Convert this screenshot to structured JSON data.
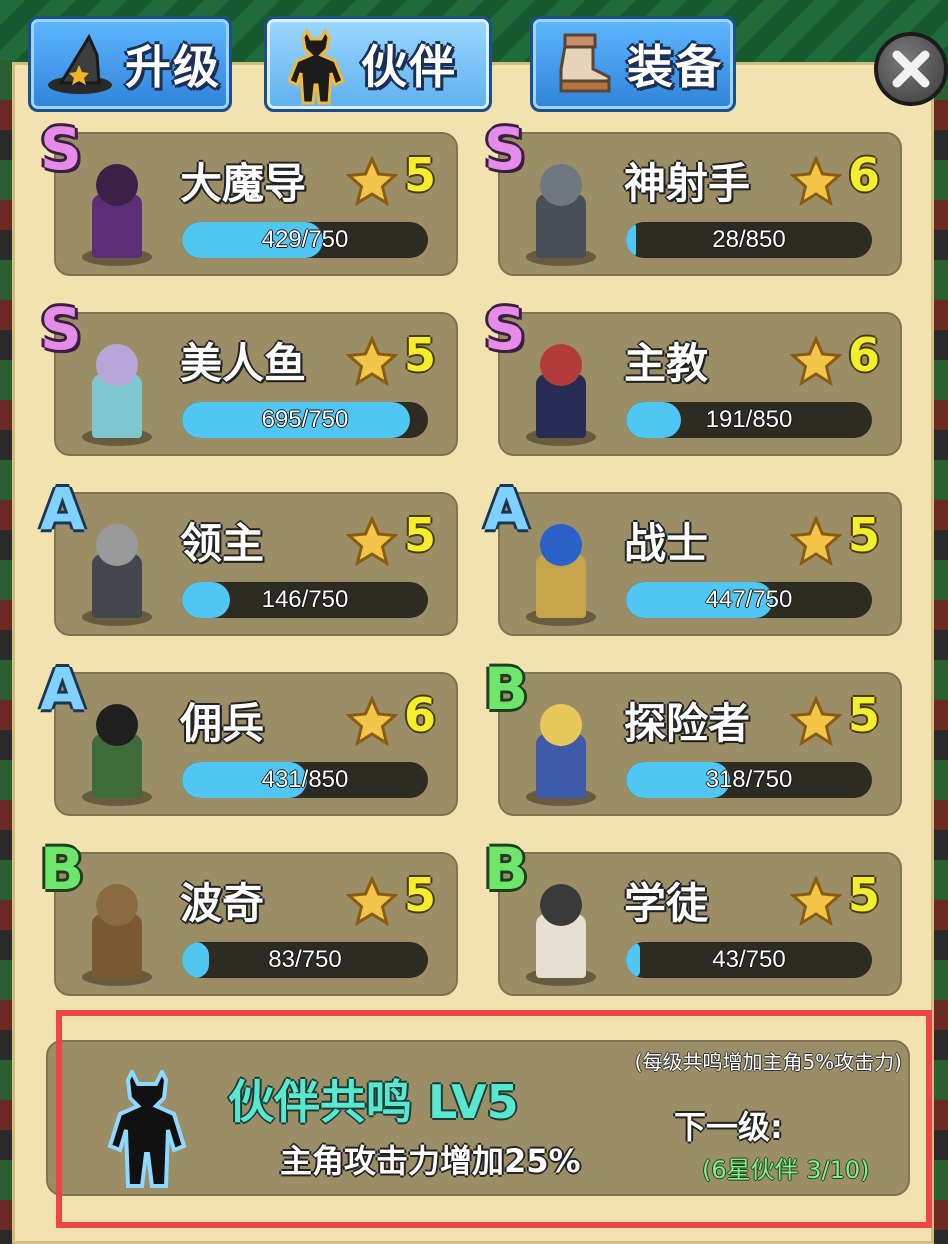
{
  "tabs": [
    {
      "label": "升级",
      "icon": "wizard-hat-icon",
      "active": false
    },
    {
      "label": "伙伴",
      "icon": "partner-silhouette-icon",
      "active": true
    },
    {
      "label": "装备",
      "icon": "boot-icon",
      "active": false
    }
  ],
  "close": {
    "icon": "close-icon"
  },
  "partners": [
    {
      "grade": "S",
      "name": "大魔导",
      "stars": "5",
      "progress_text": "429/750",
      "progress": 0.572,
      "colors": {
        "head": "#3b2148",
        "body": "#5a2f78"
      }
    },
    {
      "grade": "S",
      "name": "神射手",
      "stars": "6",
      "progress_text": "28/850",
      "progress": 0.033,
      "colors": {
        "head": "#6f7780",
        "body": "#4a4f57"
      }
    },
    {
      "grade": "S",
      "name": "美人鱼",
      "stars": "5",
      "progress_text": "695/750",
      "progress": 0.927,
      "colors": {
        "head": "#b9a6d9",
        "body": "#7fc7cf"
      }
    },
    {
      "grade": "S",
      "name": "主教",
      "stars": "6",
      "progress_text": "191/850",
      "progress": 0.225,
      "colors": {
        "head": "#b33b3b",
        "body": "#262c52"
      }
    },
    {
      "grade": "A",
      "name": "领主",
      "stars": "5",
      "progress_text": "146/750",
      "progress": 0.195,
      "colors": {
        "head": "#9a9a9a",
        "body": "#45474e"
      }
    },
    {
      "grade": "A",
      "name": "战士",
      "stars": "5",
      "progress_text": "447/750",
      "progress": 0.596,
      "colors": {
        "head": "#2c61c9",
        "body": "#c6a44b"
      }
    },
    {
      "grade": "A",
      "name": "佣兵",
      "stars": "6",
      "progress_text": "431/850",
      "progress": 0.507,
      "colors": {
        "head": "#1f1f1f",
        "body": "#3f6a3a"
      }
    },
    {
      "grade": "B",
      "name": "探险者",
      "stars": "5",
      "progress_text": "318/750",
      "progress": 0.424,
      "colors": {
        "head": "#e8c85a",
        "body": "#3f5aa8"
      }
    },
    {
      "grade": "B",
      "name": "波奇",
      "stars": "5",
      "progress_text": "83/750",
      "progress": 0.111,
      "colors": {
        "head": "#8a6a3f",
        "body": "#7a5a33"
      }
    },
    {
      "grade": "B",
      "name": "学徒",
      "stars": "5",
      "progress_text": "43/750",
      "progress": 0.057,
      "colors": {
        "head": "#3a3a3a",
        "body": "#e6e0d2"
      }
    }
  ],
  "resonance": {
    "title": "伙伴共鸣 LV5",
    "effect": "主角攻击力增加25%",
    "note": "(每级共鸣增加主角5%攻击力)",
    "next_label": "下一级:",
    "next_requirement": "(6星伙伴 3/10)"
  },
  "colors": {
    "panel": "#f1e2b0",
    "card": "#9b8e66",
    "bar_fill": "#4fc7f2",
    "highlight": "#f04546",
    "resonance_title": "#58e8d0"
  }
}
